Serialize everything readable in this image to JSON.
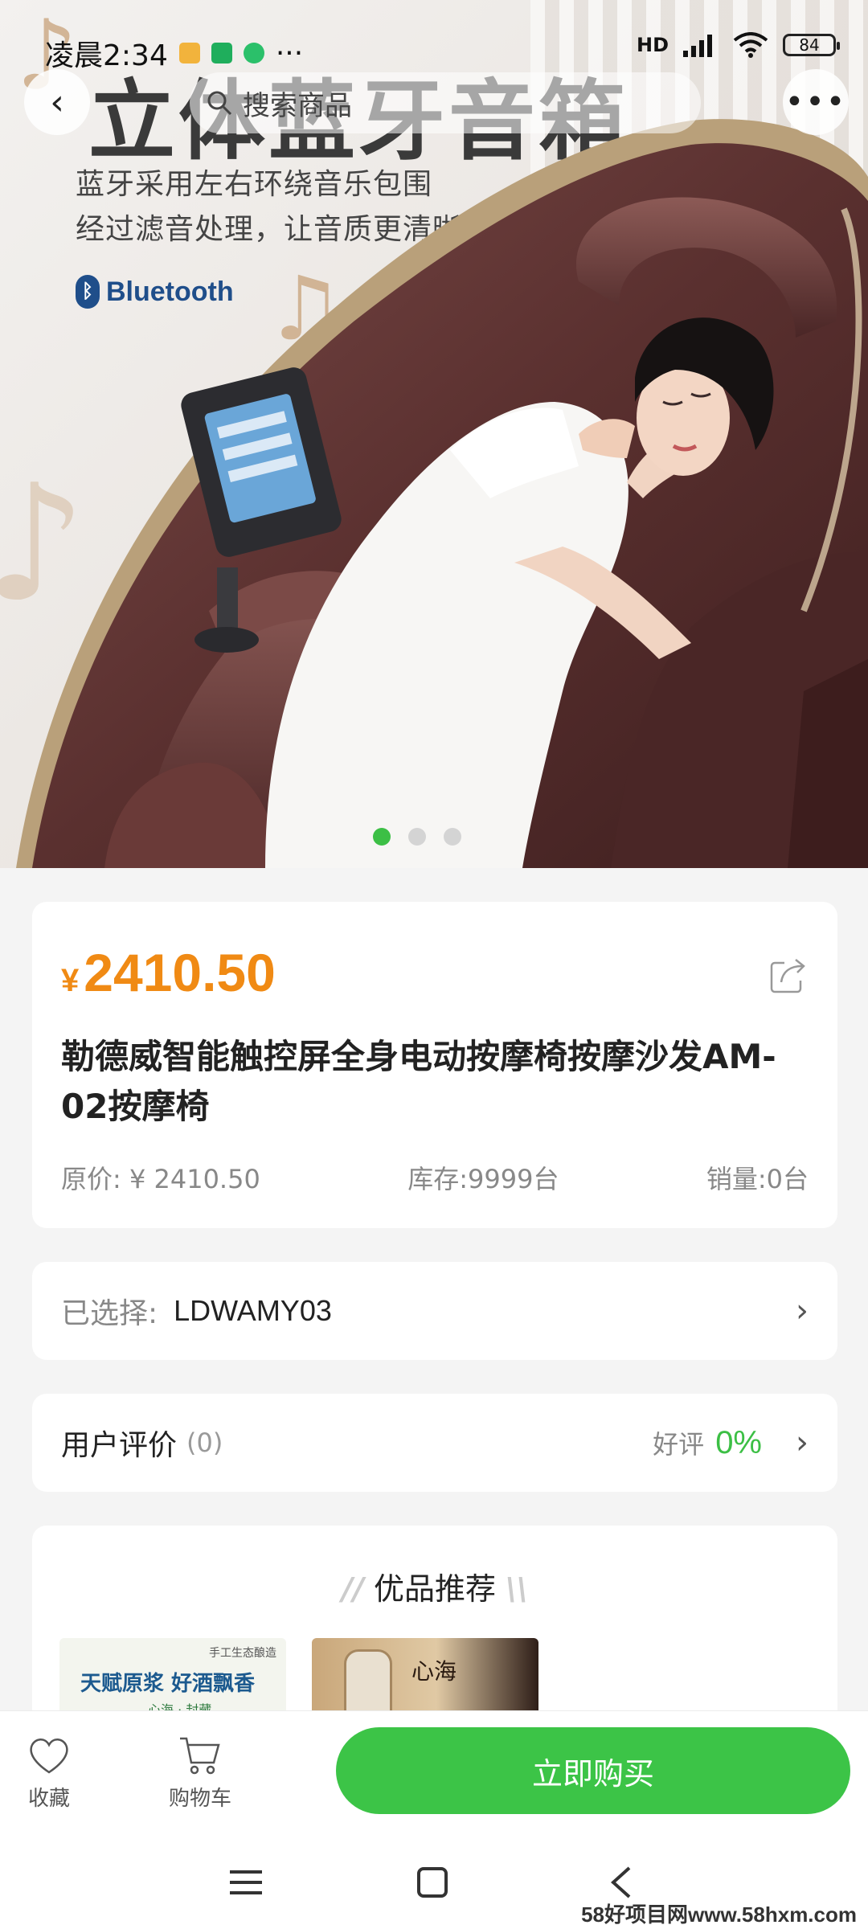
{
  "status_bar": {
    "time": "凌晨2:34",
    "more": "···",
    "network": "HD",
    "battery": "84"
  },
  "header": {
    "search_placeholder": "搜索商品"
  },
  "hero": {
    "headline": "立体蓝牙音箱",
    "line1": "蓝牙采用左右环绕音乐包围",
    "line2": "经过滤音处理，让音质更清晰出众",
    "bluetooth_label": "Bluetooth",
    "slide_count": 3,
    "active_slide": 1
  },
  "product": {
    "currency": "¥",
    "price": "2410.50",
    "title": "勒德威智能触控屏全身电动按摩椅按摩沙发AM-02按摩椅",
    "original_price": "原价: ¥ 2410.50",
    "stock": "库存:9999台",
    "sales": "销量:0台"
  },
  "selection": {
    "label": "已选择:",
    "value": "LDWAMY03"
  },
  "reviews": {
    "label": "用户评价",
    "count": "(0)",
    "good_label": "好评",
    "good_rate": "0%"
  },
  "recommend": {
    "title": "优品推荐",
    "items": [
      {
        "text": "天赋原浆 好酒飘香",
        "tag": "手工生态酿造",
        "sub": "心海 · 封藏"
      },
      {
        "text": "心海"
      }
    ]
  },
  "actions": {
    "favorite": "收藏",
    "cart": "购物车",
    "buy": "立即购买"
  },
  "watermark": "58好项目网www.58hxm.com",
  "colors": {
    "accent_green": "#3cc447",
    "price_orange": "#f08a14"
  }
}
